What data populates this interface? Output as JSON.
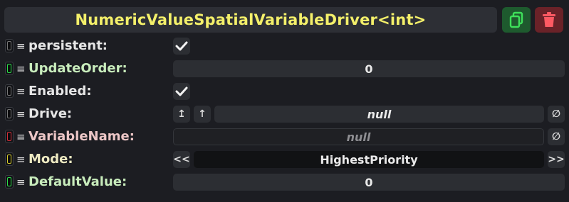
{
  "component": {
    "title": "NumericValueSpatialVariableDriver<int>"
  },
  "header_buttons": {
    "duplicate_icon": "duplicate-icon",
    "delete_icon": "trash-icon"
  },
  "fields": {
    "persistent": {
      "label": "persistent:",
      "checked": true
    },
    "update_order": {
      "label": "UpdateOrder:",
      "value": "0"
    },
    "enabled": {
      "label": "Enabled:",
      "checked": true
    },
    "drive": {
      "label": "Drive:",
      "value": "null",
      "jump_button": "↥",
      "up_button": "↑",
      "clear_button": "∅"
    },
    "variable_name": {
      "label": "VariableName:",
      "value": "null",
      "clear_button": "∅"
    },
    "mode": {
      "label": "Mode:",
      "value": "HighestPriority",
      "prev_button": "<<",
      "next_button": ">>"
    },
    "default_value": {
      "label": "DefaultValue:",
      "value": "0"
    }
  },
  "colors": {
    "title": "#f4f06a",
    "duplicate_bg": "#1e5a2e",
    "delete_bg": "#6a2228",
    "indicator_green": "#2de04a",
    "indicator_red": "#d6303a",
    "indicator_yellow": "#d8cc2c"
  }
}
